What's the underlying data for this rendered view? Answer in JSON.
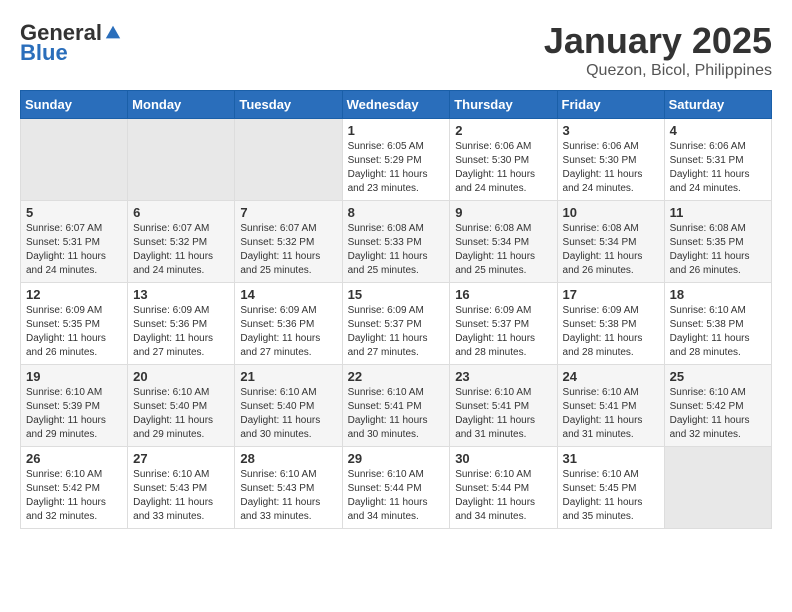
{
  "header": {
    "logo_general": "General",
    "logo_blue": "Blue",
    "month": "January 2025",
    "location": "Quezon, Bicol, Philippines"
  },
  "days_of_week": [
    "Sunday",
    "Monday",
    "Tuesday",
    "Wednesday",
    "Thursday",
    "Friday",
    "Saturday"
  ],
  "weeks": [
    [
      {
        "day": "",
        "info": ""
      },
      {
        "day": "",
        "info": ""
      },
      {
        "day": "",
        "info": ""
      },
      {
        "day": "1",
        "info": "Sunrise: 6:05 AM\nSunset: 5:29 PM\nDaylight: 11 hours and 23 minutes."
      },
      {
        "day": "2",
        "info": "Sunrise: 6:06 AM\nSunset: 5:30 PM\nDaylight: 11 hours and 24 minutes."
      },
      {
        "day": "3",
        "info": "Sunrise: 6:06 AM\nSunset: 5:30 PM\nDaylight: 11 hours and 24 minutes."
      },
      {
        "day": "4",
        "info": "Sunrise: 6:06 AM\nSunset: 5:31 PM\nDaylight: 11 hours and 24 minutes."
      }
    ],
    [
      {
        "day": "5",
        "info": "Sunrise: 6:07 AM\nSunset: 5:31 PM\nDaylight: 11 hours and 24 minutes."
      },
      {
        "day": "6",
        "info": "Sunrise: 6:07 AM\nSunset: 5:32 PM\nDaylight: 11 hours and 24 minutes."
      },
      {
        "day": "7",
        "info": "Sunrise: 6:07 AM\nSunset: 5:32 PM\nDaylight: 11 hours and 25 minutes."
      },
      {
        "day": "8",
        "info": "Sunrise: 6:08 AM\nSunset: 5:33 PM\nDaylight: 11 hours and 25 minutes."
      },
      {
        "day": "9",
        "info": "Sunrise: 6:08 AM\nSunset: 5:34 PM\nDaylight: 11 hours and 25 minutes."
      },
      {
        "day": "10",
        "info": "Sunrise: 6:08 AM\nSunset: 5:34 PM\nDaylight: 11 hours and 26 minutes."
      },
      {
        "day": "11",
        "info": "Sunrise: 6:08 AM\nSunset: 5:35 PM\nDaylight: 11 hours and 26 minutes."
      }
    ],
    [
      {
        "day": "12",
        "info": "Sunrise: 6:09 AM\nSunset: 5:35 PM\nDaylight: 11 hours and 26 minutes."
      },
      {
        "day": "13",
        "info": "Sunrise: 6:09 AM\nSunset: 5:36 PM\nDaylight: 11 hours and 27 minutes."
      },
      {
        "day": "14",
        "info": "Sunrise: 6:09 AM\nSunset: 5:36 PM\nDaylight: 11 hours and 27 minutes."
      },
      {
        "day": "15",
        "info": "Sunrise: 6:09 AM\nSunset: 5:37 PM\nDaylight: 11 hours and 27 minutes."
      },
      {
        "day": "16",
        "info": "Sunrise: 6:09 AM\nSunset: 5:37 PM\nDaylight: 11 hours and 28 minutes."
      },
      {
        "day": "17",
        "info": "Sunrise: 6:09 AM\nSunset: 5:38 PM\nDaylight: 11 hours and 28 minutes."
      },
      {
        "day": "18",
        "info": "Sunrise: 6:10 AM\nSunset: 5:38 PM\nDaylight: 11 hours and 28 minutes."
      }
    ],
    [
      {
        "day": "19",
        "info": "Sunrise: 6:10 AM\nSunset: 5:39 PM\nDaylight: 11 hours and 29 minutes."
      },
      {
        "day": "20",
        "info": "Sunrise: 6:10 AM\nSunset: 5:40 PM\nDaylight: 11 hours and 29 minutes."
      },
      {
        "day": "21",
        "info": "Sunrise: 6:10 AM\nSunset: 5:40 PM\nDaylight: 11 hours and 30 minutes."
      },
      {
        "day": "22",
        "info": "Sunrise: 6:10 AM\nSunset: 5:41 PM\nDaylight: 11 hours and 30 minutes."
      },
      {
        "day": "23",
        "info": "Sunrise: 6:10 AM\nSunset: 5:41 PM\nDaylight: 11 hours and 31 minutes."
      },
      {
        "day": "24",
        "info": "Sunrise: 6:10 AM\nSunset: 5:41 PM\nDaylight: 11 hours and 31 minutes."
      },
      {
        "day": "25",
        "info": "Sunrise: 6:10 AM\nSunset: 5:42 PM\nDaylight: 11 hours and 32 minutes."
      }
    ],
    [
      {
        "day": "26",
        "info": "Sunrise: 6:10 AM\nSunset: 5:42 PM\nDaylight: 11 hours and 32 minutes."
      },
      {
        "day": "27",
        "info": "Sunrise: 6:10 AM\nSunset: 5:43 PM\nDaylight: 11 hours and 33 minutes."
      },
      {
        "day": "28",
        "info": "Sunrise: 6:10 AM\nSunset: 5:43 PM\nDaylight: 11 hours and 33 minutes."
      },
      {
        "day": "29",
        "info": "Sunrise: 6:10 AM\nSunset: 5:44 PM\nDaylight: 11 hours and 34 minutes."
      },
      {
        "day": "30",
        "info": "Sunrise: 6:10 AM\nSunset: 5:44 PM\nDaylight: 11 hours and 34 minutes."
      },
      {
        "day": "31",
        "info": "Sunrise: 6:10 AM\nSunset: 5:45 PM\nDaylight: 11 hours and 35 minutes."
      },
      {
        "day": "",
        "info": ""
      }
    ]
  ]
}
